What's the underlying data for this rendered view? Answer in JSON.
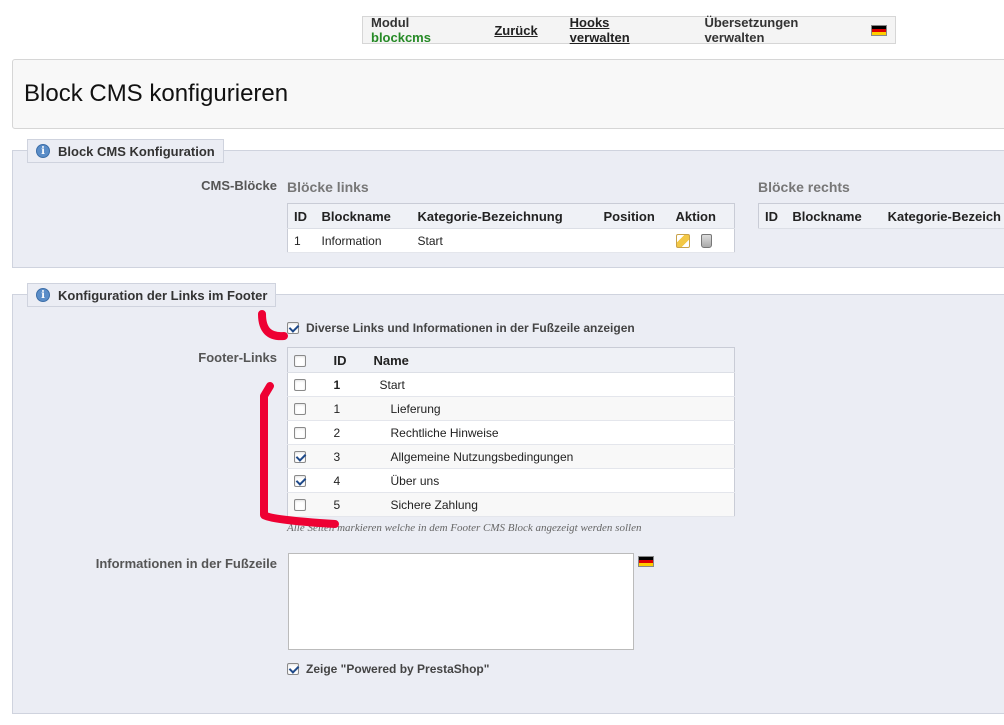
{
  "toolbar": {
    "module_prefix": "Modul",
    "module_name": "blockcms",
    "back": "Zurück",
    "hooks": "Hooks verwalten",
    "translations": "Übersetzungen verwalten",
    "flag_icon": "german-flag-icon"
  },
  "page": {
    "title": "Block CMS konfigurieren"
  },
  "section1": {
    "legend": "Block CMS Konfiguration",
    "cms_label": "CMS-Blöcke",
    "left": {
      "heading": "Blöcke links",
      "columns": [
        "ID",
        "Blockname",
        "Kategorie-Bezeichnung",
        "Position",
        "Aktion"
      ],
      "rows": [
        {
          "id": "1",
          "name": "Information",
          "category": "Start",
          "position": ""
        }
      ]
    },
    "right": {
      "heading": "Blöcke rechts",
      "columns": [
        "ID",
        "Blockname",
        "Kategorie-Bezeich"
      ]
    }
  },
  "section2": {
    "legend": "Konfiguration der Links im Footer",
    "show_links_label": "Diverse Links und Informationen in der Fußzeile anzeigen",
    "show_links_checked": true,
    "footer_links_label": "Footer-Links",
    "columns": [
      "ID",
      "Name"
    ],
    "rows": [
      {
        "id": "1",
        "name": "Start",
        "checked": false,
        "bold": true
      },
      {
        "id": "1",
        "name": "Lieferung",
        "checked": false
      },
      {
        "id": "2",
        "name": "Rechtliche Hinweise",
        "checked": false
      },
      {
        "id": "3",
        "name": "Allgemeine Nutzungsbedingungen",
        "checked": true
      },
      {
        "id": "4",
        "name": "Über uns",
        "checked": true
      },
      {
        "id": "5",
        "name": "Sichere Zahlung",
        "checked": false
      }
    ],
    "hint": "Alle Seiten markieren welche in dem Footer CMS Block angezeigt werden sollen",
    "info_label": "Informationen in der Fußzeile",
    "info_value": "",
    "powered_label": "Zeige \"Powered by PrestaShop\"",
    "powered_checked": true
  },
  "colors": {
    "module_name": "#268a26",
    "annotation": "#ee0033"
  }
}
